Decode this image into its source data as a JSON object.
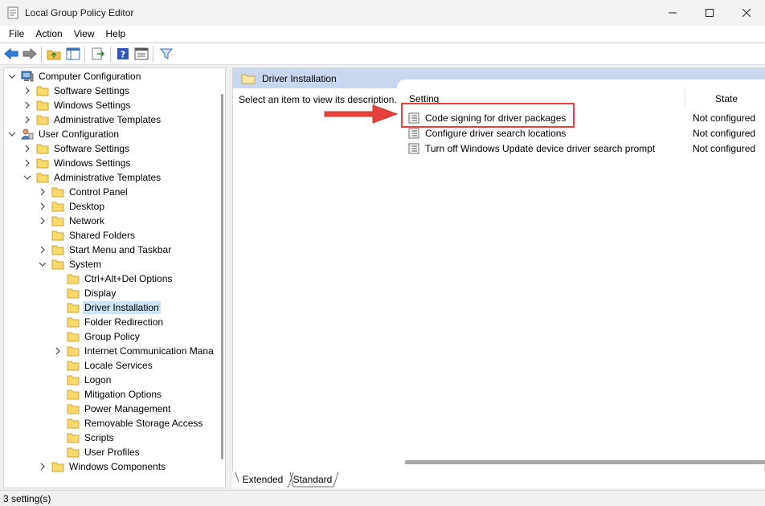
{
  "window": {
    "title": "Local Group Policy Editor"
  },
  "menu": [
    "File",
    "Action",
    "View",
    "Help"
  ],
  "tree": [
    {
      "label": "Computer Configuration",
      "level": 0,
      "expander": "open",
      "icon": "computer-icon"
    },
    {
      "label": "Software Settings",
      "level": 1,
      "expander": "closed",
      "icon": "folder-icon"
    },
    {
      "label": "Windows Settings",
      "level": 1,
      "expander": "closed",
      "icon": "folder-icon"
    },
    {
      "label": "Administrative Templates",
      "level": 1,
      "expander": "closed",
      "icon": "folder-icon"
    },
    {
      "label": "User Configuration",
      "level": 0,
      "expander": "open",
      "icon": "user-icon"
    },
    {
      "label": "Software Settings",
      "level": 1,
      "expander": "closed",
      "icon": "folder-icon"
    },
    {
      "label": "Windows Settings",
      "level": 1,
      "expander": "closed",
      "icon": "folder-icon"
    },
    {
      "label": "Administrative Templates",
      "level": 1,
      "expander": "open",
      "icon": "folder-icon"
    },
    {
      "label": "Control Panel",
      "level": 2,
      "expander": "closed",
      "icon": "folder-icon"
    },
    {
      "label": "Desktop",
      "level": 2,
      "expander": "closed",
      "icon": "folder-icon"
    },
    {
      "label": "Network",
      "level": 2,
      "expander": "closed",
      "icon": "folder-icon"
    },
    {
      "label": "Shared Folders",
      "level": 2,
      "expander": "none",
      "icon": "folder-icon"
    },
    {
      "label": "Start Menu and Taskbar",
      "level": 2,
      "expander": "closed",
      "icon": "folder-icon"
    },
    {
      "label": "System",
      "level": 2,
      "expander": "open",
      "icon": "folder-icon"
    },
    {
      "label": "Ctrl+Alt+Del Options",
      "level": 3,
      "expander": "none",
      "icon": "folder-icon"
    },
    {
      "label": "Display",
      "level": 3,
      "expander": "none",
      "icon": "folder-icon"
    },
    {
      "label": "Driver Installation",
      "level": 3,
      "expander": "none",
      "icon": "folder-icon",
      "selected": true
    },
    {
      "label": "Folder Redirection",
      "level": 3,
      "expander": "none",
      "icon": "folder-icon"
    },
    {
      "label": "Group Policy",
      "level": 3,
      "expander": "none",
      "icon": "folder-icon"
    },
    {
      "label": "Internet Communication Mana",
      "level": 3,
      "expander": "closed",
      "icon": "folder-icon"
    },
    {
      "label": "Locale Services",
      "level": 3,
      "expander": "none",
      "icon": "folder-icon"
    },
    {
      "label": "Logon",
      "level": 3,
      "expander": "none",
      "icon": "folder-icon"
    },
    {
      "label": "Mitigation Options",
      "level": 3,
      "expander": "none",
      "icon": "folder-icon"
    },
    {
      "label": "Power Management",
      "level": 3,
      "expander": "none",
      "icon": "folder-icon"
    },
    {
      "label": "Removable Storage Access",
      "level": 3,
      "expander": "none",
      "icon": "folder-icon"
    },
    {
      "label": "Scripts",
      "level": 3,
      "expander": "none",
      "icon": "folder-icon"
    },
    {
      "label": "User Profiles",
      "level": 3,
      "expander": "none",
      "icon": "folder-icon"
    },
    {
      "label": "Windows Components",
      "level": 2,
      "expander": "closed",
      "icon": "folder-icon"
    }
  ],
  "details": {
    "header": "Driver Installation",
    "description": "Select an item to view its description.",
    "columns": {
      "setting": "Setting",
      "state": "State"
    },
    "rows": [
      {
        "setting": "Code signing for driver packages",
        "state": "Not configured"
      },
      {
        "setting": "Configure driver search locations",
        "state": "Not configured"
      },
      {
        "setting": "Turn off Windows Update device driver search prompt",
        "state": "Not configured"
      }
    ]
  },
  "tabs": [
    "Extended",
    "Standard"
  ],
  "status": "3 setting(s)",
  "colors": {
    "accent_annotation": "#e8413c",
    "header_bg": "#c9d7ee",
    "selection": "#cce4f7"
  }
}
